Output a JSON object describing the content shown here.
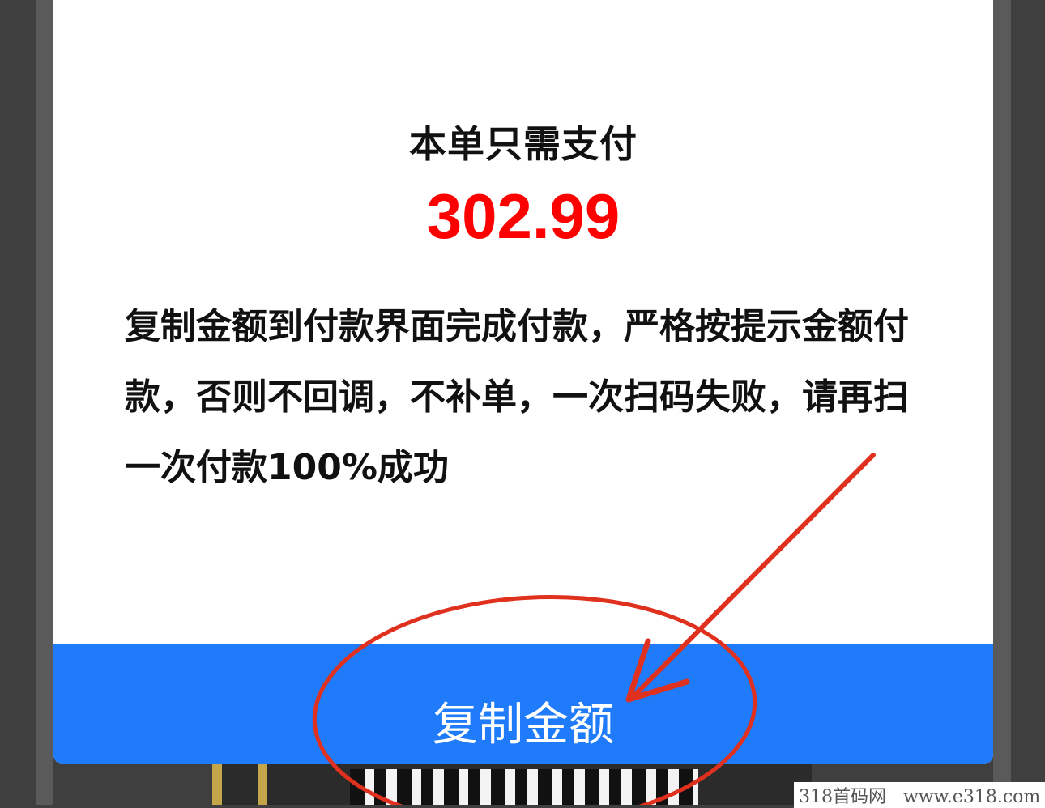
{
  "dialog": {
    "title": "本单只需支付",
    "amount": "302.99",
    "notice": "复制金额到付款界面完成付款，严格按提示金额付款，否则不回调，不补单，一次扫码失败，请再扫一次付款100%成功",
    "copy_button_label": "复制金额"
  },
  "watermark": {
    "text": "318首码网   www.e318.com"
  },
  "colors": {
    "amount": "#ff0000",
    "button": "#1f7bfa",
    "annotation": "#e0301e"
  }
}
